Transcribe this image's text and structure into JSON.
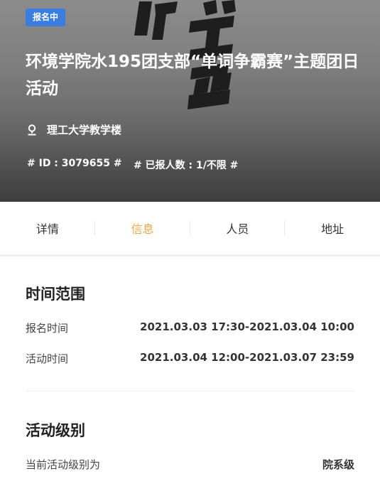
{
  "hero": {
    "status_badge": "报名中",
    "title": "环境学院水195团支部“单词争霸赛”主题团日活动",
    "location": "理工大学教学楼",
    "id_tag": "# ID : 3079655 #",
    "signup_count_tag": "# 已报人数 : 1/不限 #",
    "background_icon": "event-poster-art"
  },
  "tabs": [
    {
      "label": "详情",
      "active": false
    },
    {
      "label": "信息",
      "active": true
    },
    {
      "label": "人员",
      "active": false
    },
    {
      "label": "地址",
      "active": false
    }
  ],
  "time_section": {
    "title": "时间范围",
    "rows": [
      {
        "label": "报名时间",
        "value": "2021.03.03 17:30-2021.03.04 10:00"
      },
      {
        "label": "活动时间",
        "value": "2021.03.04 12:00-2021.03.07 23:59"
      }
    ]
  },
  "level_section": {
    "title": "活动级别",
    "label": "当前活动级别为",
    "value": "院系级"
  },
  "colors": {
    "badge": "#3a7de0",
    "active_tab": "#e9a74b"
  }
}
